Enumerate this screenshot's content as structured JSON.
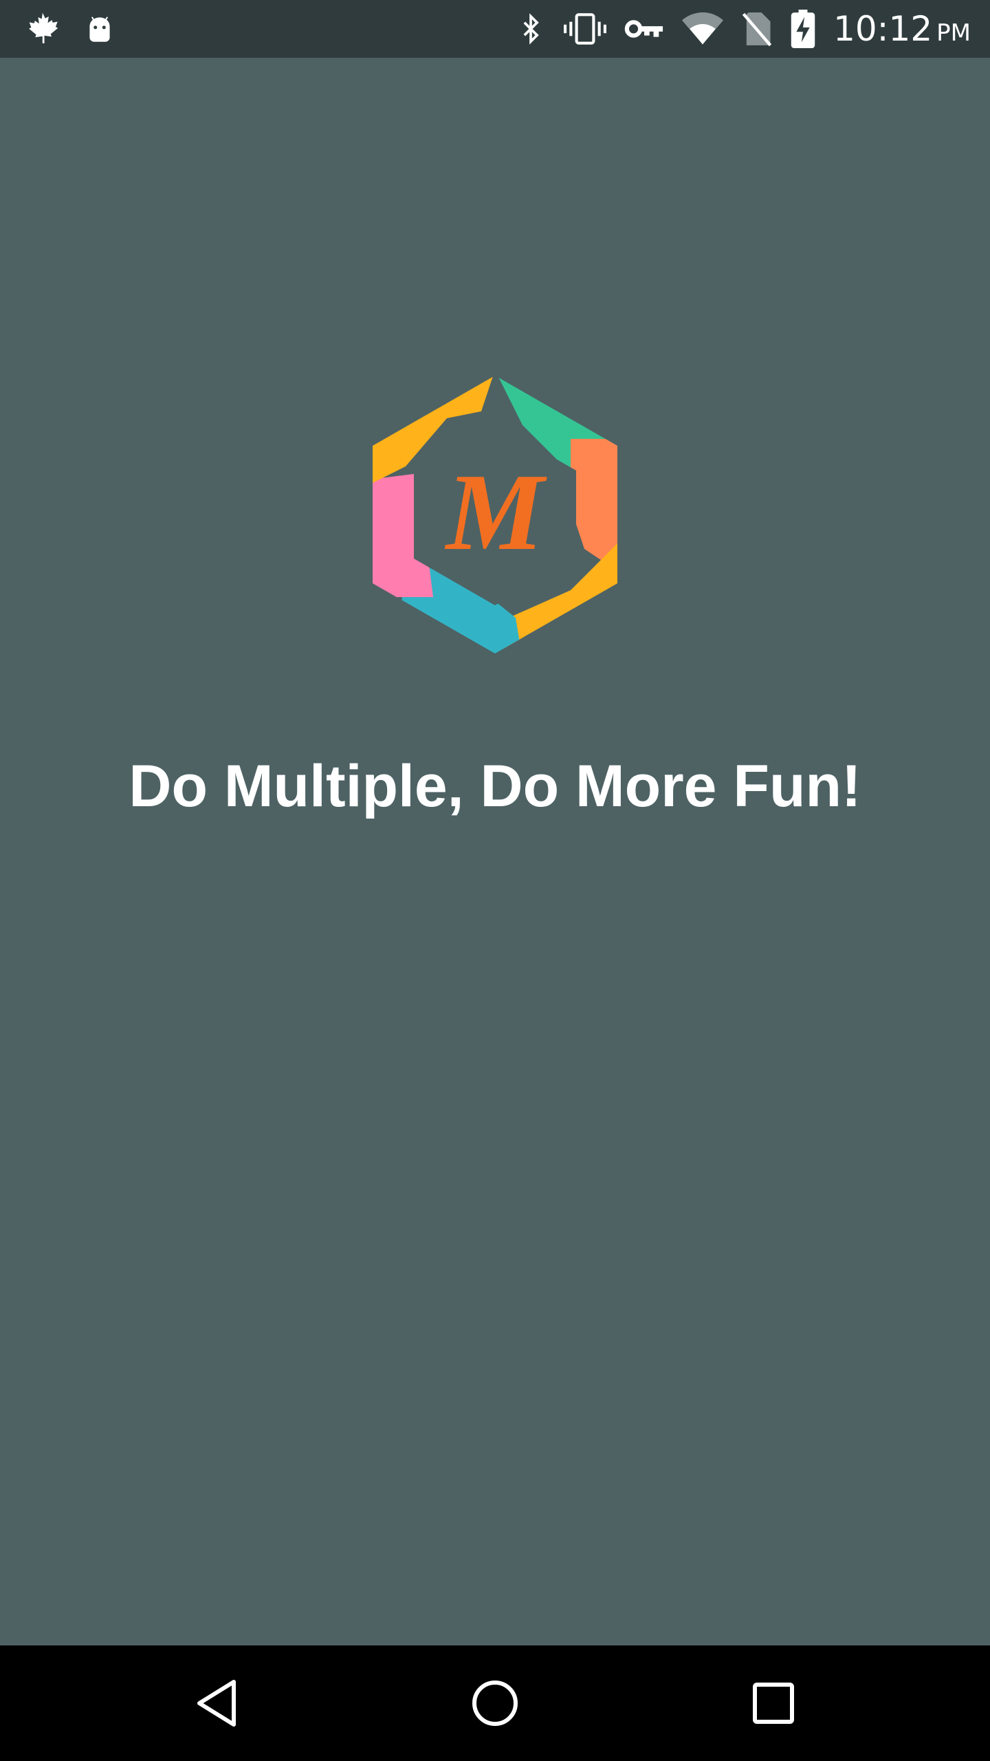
{
  "status_bar": {
    "left_icons": [
      "maple-leaf-icon",
      "android-robot-icon"
    ],
    "right_icons": [
      "bluetooth-icon",
      "vibrate-icon",
      "vpn-key-icon",
      "wifi-icon",
      "no-sim-icon",
      "battery-charging-icon"
    ],
    "time": "10:12",
    "ampm": "PM"
  },
  "splash": {
    "logo_letter": "M",
    "tagline": "Do Multiple, Do More Fun!"
  },
  "colors": {
    "background": "#4e6264",
    "status_bar": "#2f3b3d",
    "nav_bar": "#000000",
    "logo_letter": "#f26f21",
    "logo_green": "#35c594",
    "logo_orange": "#ff8651",
    "logo_yellow": "#ffb219",
    "logo_pink": "#ff7daf",
    "logo_teal": "#33b4c6"
  },
  "nav_bar": {
    "buttons": [
      "back-icon",
      "home-icon",
      "recents-icon"
    ]
  }
}
